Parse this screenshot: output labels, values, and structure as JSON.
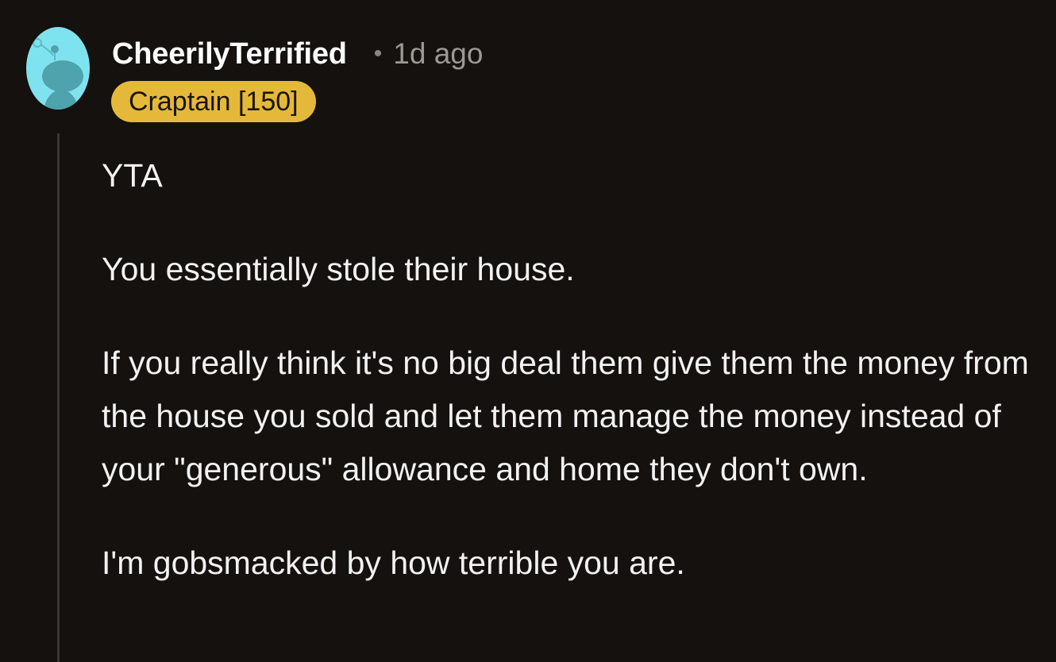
{
  "comment": {
    "avatar_icon": "snoo-avatar-icon",
    "username": "CheerilyTerrified",
    "separator": "•",
    "timestamp": "1d ago",
    "flair": "Craptain [150]",
    "paragraphs": [
      "YTA",
      "You essentially stole their house.",
      "If you really think it's no big deal them give them the money from the house you sold and let them manage the money instead of your \"generous\" allowance and home they don't own.",
      "I'm gobsmacked by how terrible you are."
    ]
  },
  "colors": {
    "background": "#14110f",
    "flair_background": "#e4b93a",
    "avatar_background": "#7fe3ef",
    "text": "#f2f2f2",
    "muted": "#9e9893"
  }
}
